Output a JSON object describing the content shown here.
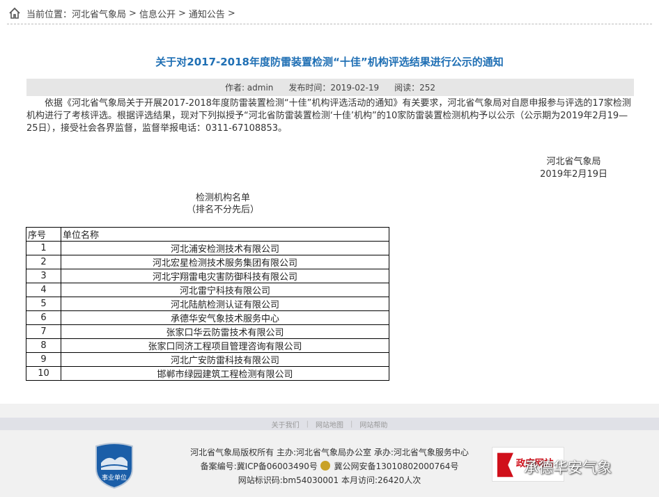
{
  "breadcrumb": {
    "prefix": "当前位置：",
    "items": [
      "河北省气象局",
      "信息公开",
      "通知公告"
    ],
    "separator": ">"
  },
  "article": {
    "title": "关于对2017-2018年度防雷装置检测“十佳”机构评选结果进行公示的通知",
    "author_label": "作者: admin",
    "publish_label": "发布时间：2019-02-19",
    "reads_label": "阅读：252",
    "body": "依据《河北省气象局关于开展2017-2018年度防雷装置检测“十佳”机构评选活动的通知》有关要求，河北省气象局对自愿申报参与评选的17家检测机构进行了考核评选。根据评选结果，现对下列拟授予“河北省防雷装置检测‘十佳’机构”的10家防雷装置检测机构予以公示（公示期为2019年2月19—25日），接受社会各界监督，监督举报电话：0311-67108853。",
    "signer_org": "河北省气象局",
    "signer_date": "2019年2月19日",
    "list_title": "检测机构名单",
    "list_subtitle": "（排名不分先后）"
  },
  "table": {
    "headers": [
      "序号",
      "单位名称"
    ],
    "rows": [
      [
        "1",
        "河北浦安检测技术有限公司"
      ],
      [
        "2",
        "河北宏星检测技术服务集团有限公司"
      ],
      [
        "3",
        "河北宇翔雷电灾害防御科技有限公司"
      ],
      [
        "4",
        "河北雷宁科技有限公司"
      ],
      [
        "5",
        "河北陆航检测认证有限公司"
      ],
      [
        "6",
        "承德华安气象技术服务中心"
      ],
      [
        "7",
        "张家口华云防雷技术有限公司"
      ],
      [
        "8",
        "张家口同济工程项目管理咨询有限公司"
      ],
      [
        "9",
        "河北广安防雷科技有限公司"
      ],
      [
        "10",
        "邯郸市绿园建筑工程检测有限公司"
      ]
    ]
  },
  "footer": {
    "links": [
      "关于我们",
      "网站地图",
      "网站帮助"
    ],
    "line1": "河北省气象局版权所有 主办:河北省气象局办公室 承办:河北省气象服务中心",
    "line2a": "备案编号:冀ICP备06003490号",
    "line2b": "冀公网安备13010802000764号",
    "line3": "网站标识码:bm54030001  本月访问:26420人次",
    "badge_text": "事业单位",
    "gov_site_text": "政府网站",
    "watermark": "承德华安气象"
  },
  "colors": {
    "title_blue": "#1f6fb4",
    "meta_bg": "#e6e6e6",
    "footer_bg": "#f1f1f1",
    "badge_blue": "#1b5ea8"
  }
}
